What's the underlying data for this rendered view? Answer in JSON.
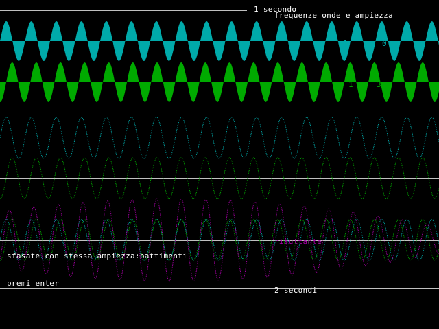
{
  "labels": {
    "one_second": "1 secondo",
    "header": "frequenze onde e ampiezza",
    "wave1_freq": "1",
    "wave1_amp": "0",
    "wave2_freq": "1",
    "wave2_amp": "3",
    "resultant": "risultante",
    "caption": "sfasate con stessa ampiezza:battimenti",
    "prompt": "premi enter",
    "two_seconds": "2 secondi"
  },
  "colors": {
    "background": "#000000",
    "text": "#ffffff",
    "wave_teal": "#00aaaa",
    "wave_green": "#00aa00",
    "resultant": "#aa00aa",
    "baseline": "#c0c0c0"
  }
}
